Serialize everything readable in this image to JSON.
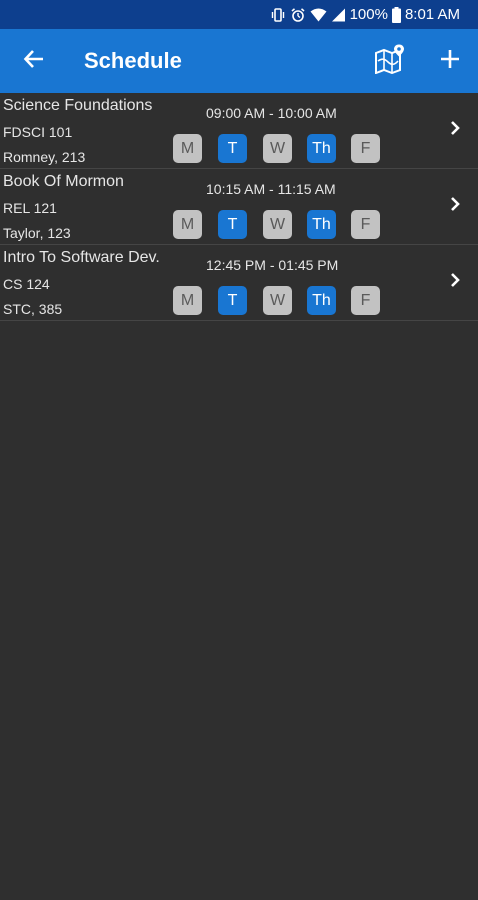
{
  "status_bar": {
    "battery": "100%",
    "time": "8:01 AM"
  },
  "app_bar": {
    "title": "Schedule"
  },
  "colors": {
    "status_bar": "#0d3f8e",
    "app_bar": "#1976d2",
    "background": "#2f2f2f",
    "day_active": "#1976d2",
    "day_inactive": "#c2c2c2"
  },
  "courses": [
    {
      "name": "Science Foundations",
      "code": "FDSCI 101",
      "room": "Romney, 213",
      "time": "09:00 AM - 10:00 AM",
      "days": [
        {
          "label": "M",
          "active": false
        },
        {
          "label": "T",
          "active": true
        },
        {
          "label": "W",
          "active": false
        },
        {
          "label": "Th",
          "active": true
        },
        {
          "label": "F",
          "active": false
        }
      ]
    },
    {
      "name": "Book Of Mormon",
      "code": "REL 121",
      "room": "Taylor, 123",
      "time": "10:15 AM - 11:15 AM",
      "days": [
        {
          "label": "M",
          "active": false
        },
        {
          "label": "T",
          "active": true
        },
        {
          "label": "W",
          "active": false
        },
        {
          "label": "Th",
          "active": true
        },
        {
          "label": "F",
          "active": false
        }
      ]
    },
    {
      "name": "Intro To Software Dev.",
      "code": "CS 124",
      "room": "STC, 385",
      "time": "12:45 PM - 01:45 PM",
      "days": [
        {
          "label": "M",
          "active": false
        },
        {
          "label": "T",
          "active": true
        },
        {
          "label": "W",
          "active": false
        },
        {
          "label": "Th",
          "active": true
        },
        {
          "label": "F",
          "active": false
        }
      ]
    }
  ]
}
